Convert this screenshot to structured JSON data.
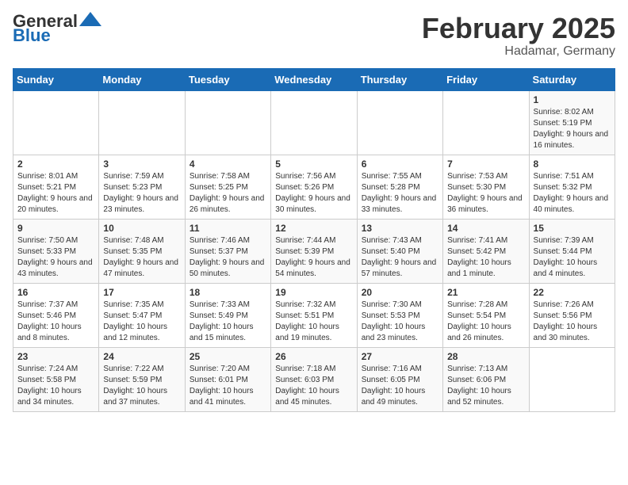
{
  "header": {
    "logo_general": "General",
    "logo_blue": "Blue",
    "month": "February 2025",
    "location": "Hadamar, Germany"
  },
  "days_of_week": [
    "Sunday",
    "Monday",
    "Tuesday",
    "Wednesday",
    "Thursday",
    "Friday",
    "Saturday"
  ],
  "weeks": [
    [
      {
        "day": "",
        "info": ""
      },
      {
        "day": "",
        "info": ""
      },
      {
        "day": "",
        "info": ""
      },
      {
        "day": "",
        "info": ""
      },
      {
        "day": "",
        "info": ""
      },
      {
        "day": "",
        "info": ""
      },
      {
        "day": "1",
        "info": "Sunrise: 8:02 AM\nSunset: 5:19 PM\nDaylight: 9 hours and 16 minutes."
      }
    ],
    [
      {
        "day": "2",
        "info": "Sunrise: 8:01 AM\nSunset: 5:21 PM\nDaylight: 9 hours and 20 minutes."
      },
      {
        "day": "3",
        "info": "Sunrise: 7:59 AM\nSunset: 5:23 PM\nDaylight: 9 hours and 23 minutes."
      },
      {
        "day": "4",
        "info": "Sunrise: 7:58 AM\nSunset: 5:25 PM\nDaylight: 9 hours and 26 minutes."
      },
      {
        "day": "5",
        "info": "Sunrise: 7:56 AM\nSunset: 5:26 PM\nDaylight: 9 hours and 30 minutes."
      },
      {
        "day": "6",
        "info": "Sunrise: 7:55 AM\nSunset: 5:28 PM\nDaylight: 9 hours and 33 minutes."
      },
      {
        "day": "7",
        "info": "Sunrise: 7:53 AM\nSunset: 5:30 PM\nDaylight: 9 hours and 36 minutes."
      },
      {
        "day": "8",
        "info": "Sunrise: 7:51 AM\nSunset: 5:32 PM\nDaylight: 9 hours and 40 minutes."
      }
    ],
    [
      {
        "day": "9",
        "info": "Sunrise: 7:50 AM\nSunset: 5:33 PM\nDaylight: 9 hours and 43 minutes."
      },
      {
        "day": "10",
        "info": "Sunrise: 7:48 AM\nSunset: 5:35 PM\nDaylight: 9 hours and 47 minutes."
      },
      {
        "day": "11",
        "info": "Sunrise: 7:46 AM\nSunset: 5:37 PM\nDaylight: 9 hours and 50 minutes."
      },
      {
        "day": "12",
        "info": "Sunrise: 7:44 AM\nSunset: 5:39 PM\nDaylight: 9 hours and 54 minutes."
      },
      {
        "day": "13",
        "info": "Sunrise: 7:43 AM\nSunset: 5:40 PM\nDaylight: 9 hours and 57 minutes."
      },
      {
        "day": "14",
        "info": "Sunrise: 7:41 AM\nSunset: 5:42 PM\nDaylight: 10 hours and 1 minute."
      },
      {
        "day": "15",
        "info": "Sunrise: 7:39 AM\nSunset: 5:44 PM\nDaylight: 10 hours and 4 minutes."
      }
    ],
    [
      {
        "day": "16",
        "info": "Sunrise: 7:37 AM\nSunset: 5:46 PM\nDaylight: 10 hours and 8 minutes."
      },
      {
        "day": "17",
        "info": "Sunrise: 7:35 AM\nSunset: 5:47 PM\nDaylight: 10 hours and 12 minutes."
      },
      {
        "day": "18",
        "info": "Sunrise: 7:33 AM\nSunset: 5:49 PM\nDaylight: 10 hours and 15 minutes."
      },
      {
        "day": "19",
        "info": "Sunrise: 7:32 AM\nSunset: 5:51 PM\nDaylight: 10 hours and 19 minutes."
      },
      {
        "day": "20",
        "info": "Sunrise: 7:30 AM\nSunset: 5:53 PM\nDaylight: 10 hours and 23 minutes."
      },
      {
        "day": "21",
        "info": "Sunrise: 7:28 AM\nSunset: 5:54 PM\nDaylight: 10 hours and 26 minutes."
      },
      {
        "day": "22",
        "info": "Sunrise: 7:26 AM\nSunset: 5:56 PM\nDaylight: 10 hours and 30 minutes."
      }
    ],
    [
      {
        "day": "23",
        "info": "Sunrise: 7:24 AM\nSunset: 5:58 PM\nDaylight: 10 hours and 34 minutes."
      },
      {
        "day": "24",
        "info": "Sunrise: 7:22 AM\nSunset: 5:59 PM\nDaylight: 10 hours and 37 minutes."
      },
      {
        "day": "25",
        "info": "Sunrise: 7:20 AM\nSunset: 6:01 PM\nDaylight: 10 hours and 41 minutes."
      },
      {
        "day": "26",
        "info": "Sunrise: 7:18 AM\nSunset: 6:03 PM\nDaylight: 10 hours and 45 minutes."
      },
      {
        "day": "27",
        "info": "Sunrise: 7:16 AM\nSunset: 6:05 PM\nDaylight: 10 hours and 49 minutes."
      },
      {
        "day": "28",
        "info": "Sunrise: 7:13 AM\nSunset: 6:06 PM\nDaylight: 10 hours and 52 minutes."
      },
      {
        "day": "",
        "info": ""
      }
    ]
  ]
}
